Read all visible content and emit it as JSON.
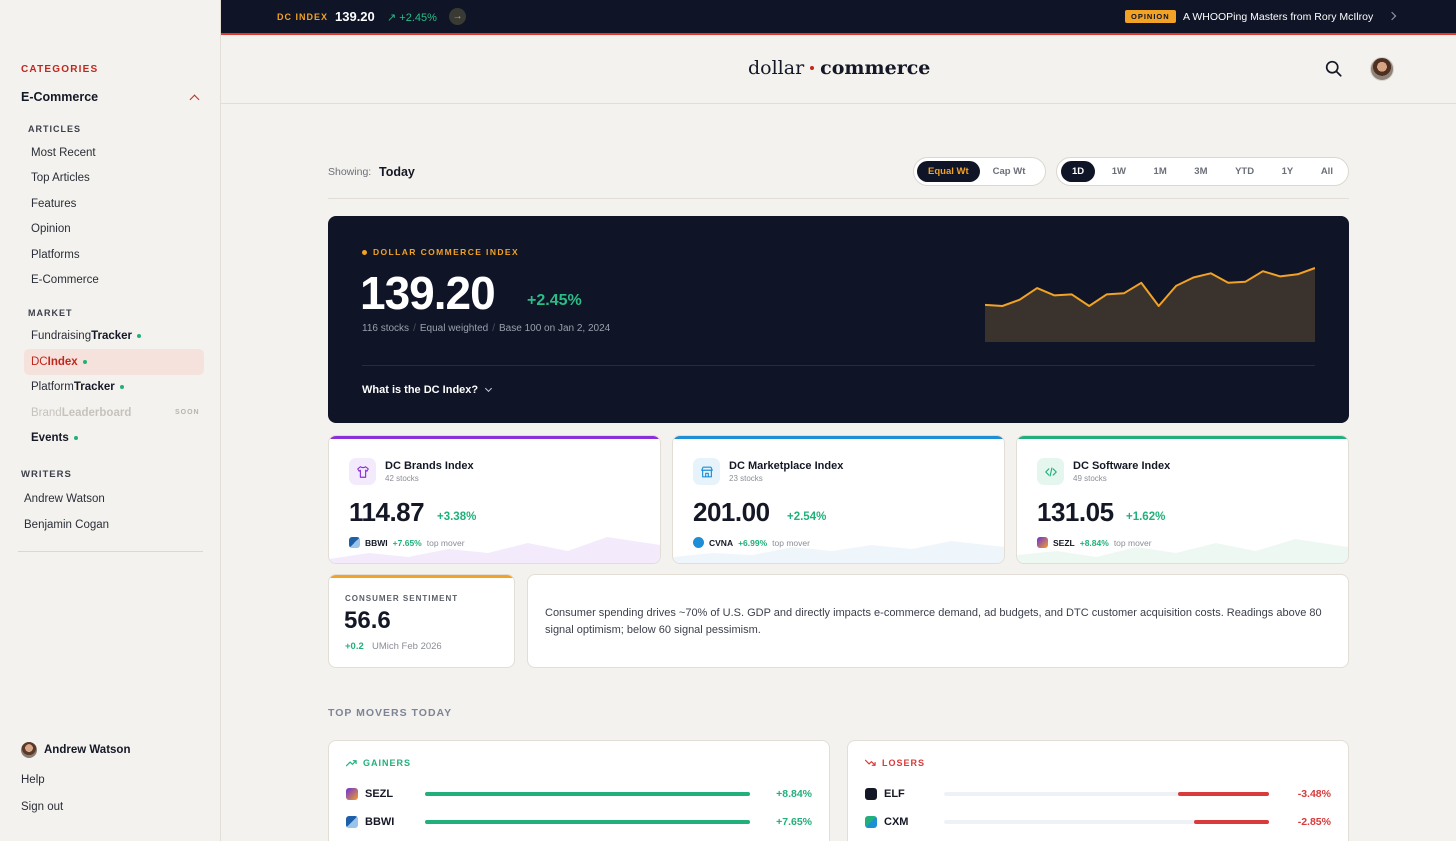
{
  "sidebar": {
    "categories_label": "CATEGORIES",
    "category": "E-Commerce",
    "articles_label": "ARTICLES",
    "articles": [
      "Most Recent",
      "Top Articles",
      "Features",
      "Opinion",
      "Platforms",
      "E-Commerce"
    ],
    "market_label": "MARKET",
    "market": [
      {
        "a": "Fundraising",
        "b": "Tracker"
      },
      {
        "a": "DC",
        "b": "Index"
      },
      {
        "a": "Platform",
        "b": "Tracker"
      },
      {
        "a": "Brand",
        "b": "Leaderboard",
        "badge": "SOON"
      },
      {
        "a": "",
        "b": "Events"
      }
    ],
    "writers_label": "WRITERS",
    "writers": [
      "Andrew Watson",
      "Benjamin Cogan"
    ],
    "user_name": "Andrew Watson",
    "help": "Help",
    "sign_out": "Sign out"
  },
  "ticker": {
    "label": "DC INDEX",
    "value": "139.20",
    "change": "↗ +2.45%",
    "opinion_badge": "OPINION",
    "opinion_title": "A WHOOPing Masters from Rory McIlroy"
  },
  "header": {
    "brand_a": "dollar",
    "brand_b": "commerce"
  },
  "controls": {
    "showing_label": "Showing:",
    "showing_value": "Today",
    "weights": [
      "Equal Wt",
      "Cap Wt"
    ],
    "ranges": [
      "1D",
      "1W",
      "1M",
      "3M",
      "YTD",
      "1Y",
      "All"
    ]
  },
  "hero": {
    "label": "DOLLAR COMMERCE INDEX",
    "value": "139.20",
    "change": "+2.45%",
    "meta": [
      "116 stocks",
      "Equal weighted",
      "Base 100 on Jan 2, 2024"
    ],
    "what": "What is the DC Index?",
    "spark": [
      36,
      37,
      31,
      20,
      27,
      26,
      37,
      26,
      25,
      15,
      37,
      18,
      10,
      6,
      15,
      14,
      4,
      9,
      7,
      1
    ]
  },
  "cards": [
    {
      "title": "DC Brands Index",
      "sub": "42 stocks",
      "value": "114.87",
      "change": "+3.38%",
      "mover": "BBWI",
      "mover_change": "+7.65%",
      "mover_label": "top mover",
      "color": "#8b2fd9",
      "tint": "#f3eafc"
    },
    {
      "title": "DC Marketplace Index",
      "sub": "23 stocks",
      "value": "201.00",
      "change": "+2.54%",
      "mover": "CVNA",
      "mover_change": "+6.99%",
      "mover_label": "top mover",
      "color": "#1e8fd6",
      "tint": "#e6f3fb"
    },
    {
      "title": "DC Software Index",
      "sub": "49 stocks",
      "value": "131.05",
      "change": "+1.62%",
      "mover": "SEZL",
      "mover_change": "+8.84%",
      "mover_label": "top mover",
      "color": "#21b07a",
      "tint": "#e5f6ee"
    }
  ],
  "sentiment": {
    "label": "CONSUMER SENTIMENT",
    "value": "56.6",
    "change": "+0.2",
    "source": "UMich Feb 2026",
    "description": "Consumer spending drives ~70% of U.S. GDP and directly impacts e-commerce demand, ad budgets, and DTC customer acquisition costs. Readings above 80 signal optimism; below 60 signal pessimism."
  },
  "movers": {
    "label": "TOP MOVERS TODAY",
    "gainers_label": "GAINERS",
    "losers_label": "LOSERS",
    "gainers": [
      {
        "ticker": "SEZL",
        "change": "+8.84%",
        "pct": 100
      },
      {
        "ticker": "BBWI",
        "change": "+7.65%",
        "pct": 100
      }
    ],
    "losers": [
      {
        "ticker": "ELF",
        "change": "-3.48%",
        "pct": 28
      },
      {
        "ticker": "CXM",
        "change": "-2.85%",
        "pct": 23
      }
    ],
    "gain_color": "#21b07a",
    "loss_color": "#d93a3a"
  }
}
